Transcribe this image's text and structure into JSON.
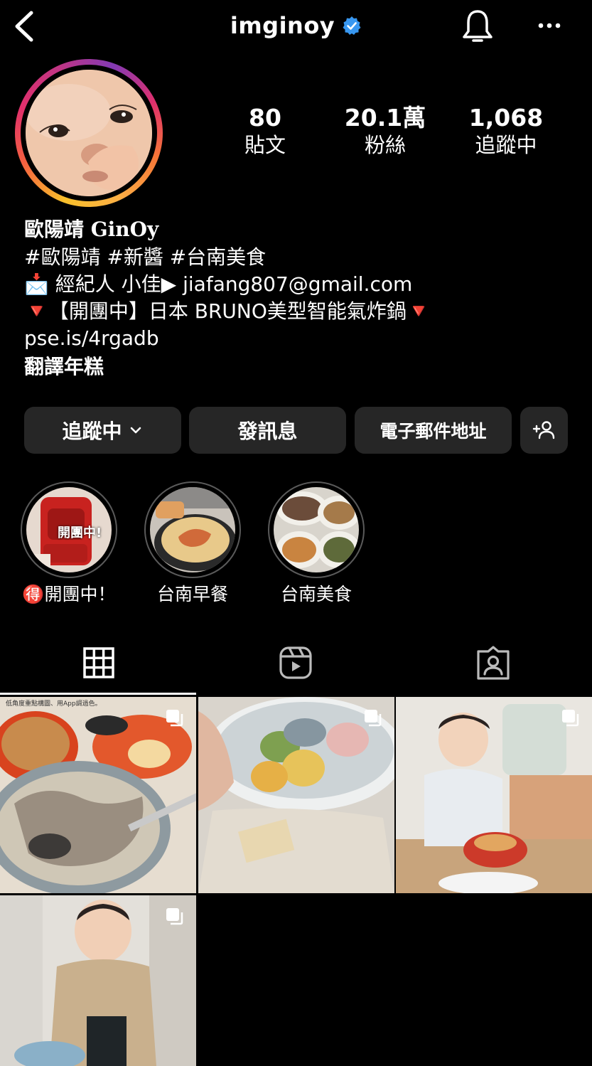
{
  "header": {
    "username": "imginoy",
    "verified": true,
    "icons": [
      "back-arrow-icon",
      "verified-badge-icon",
      "bell-icon",
      "more-icon"
    ]
  },
  "stats": [
    {
      "value": "80",
      "label": "貼文"
    },
    {
      "value": "20.1萬",
      "label": "粉絲"
    },
    {
      "value": "1,068",
      "label": "追蹤中"
    }
  ],
  "bio": {
    "name": "歐陽靖 GinOy",
    "tags": "#歐陽靖 #新醬 #台南美食",
    "agent_emoji": "📩",
    "agent": "經紀人 小佳▶ jiafang807@gmail.com",
    "promo": "🔻【開團中】日本 BRUNO美型智能氣炸鍋🔻",
    "link": "pse.is/4rgadb",
    "translate": "翻譯年糕"
  },
  "buttons": {
    "following": "追蹤中",
    "message": "發訊息",
    "email": "電子郵件地址"
  },
  "highlights": [
    {
      "label": "🉐開團中！",
      "overlay": "開團中!"
    },
    {
      "label": "台南早餐"
    },
    {
      "label": "台南美食"
    }
  ],
  "grid_note": "低角度重點構圖、用App調過色。",
  "colors": {
    "background": "#000000",
    "button": "#262626",
    "verified": "#3897f0"
  }
}
